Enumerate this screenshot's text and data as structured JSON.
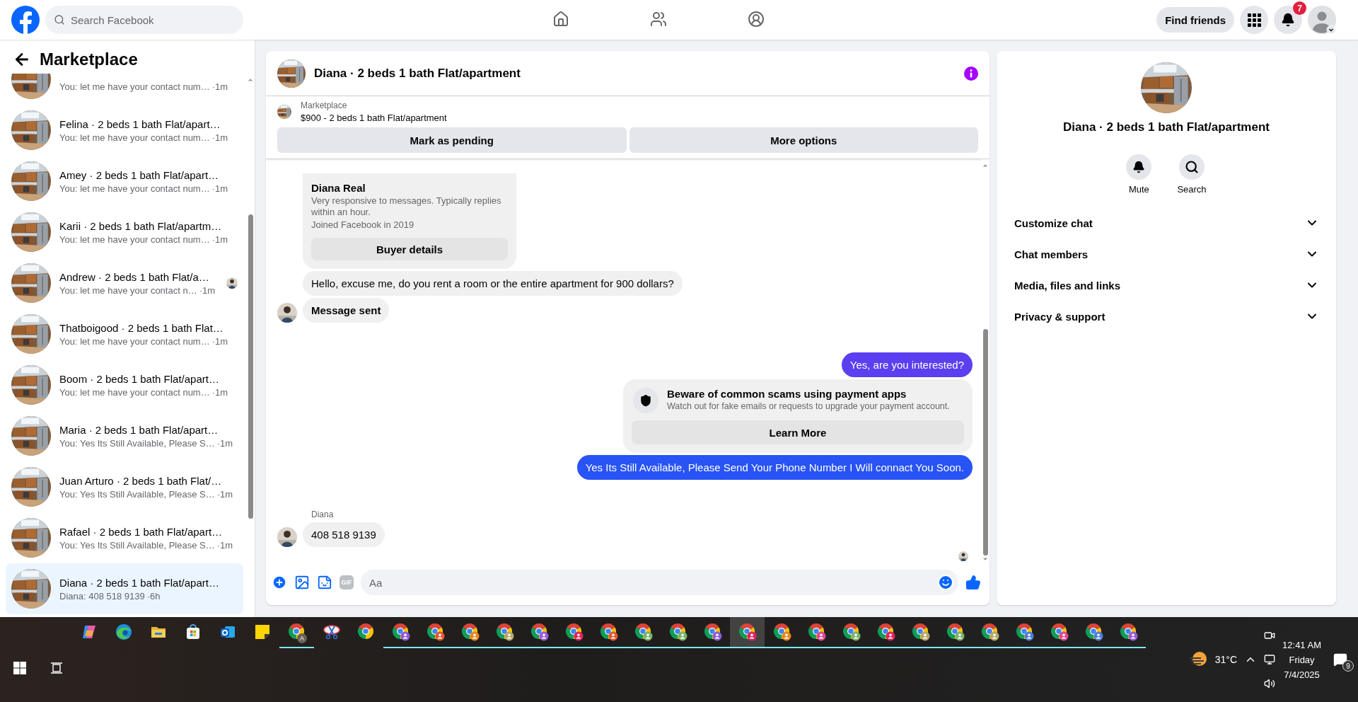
{
  "top_bar": {
    "search": {
      "placeholder": "Search Facebook"
    },
    "nav": [
      {
        "kind": "home",
        "selected": false
      },
      {
        "kind": "friends",
        "selected": false
      },
      {
        "kind": "groups",
        "selected": false
      }
    ],
    "find_friends": "Find friends",
    "notifications_badge": "7"
  },
  "sidebar": {
    "title": "Marketplace",
    "conversations": [
      {
        "preview": "You: let me have your contact num…",
        "time": "·1m",
        "selected": false,
        "seen_avatar": false
      },
      {
        "title": "Felina · 2 beds 1 bath Flat/apart…",
        "preview": "You: let me have your contact num…",
        "time": "·1m",
        "selected": false,
        "seen_avatar": false
      },
      {
        "title": "Amey · 2 beds 1 bath Flat/apart…",
        "preview": "You: let me have your contact num…",
        "time": "·1m",
        "selected": false,
        "seen_avatar": false
      },
      {
        "title": "Karii · 2 beds 1 bath Flat/apartm…",
        "preview": "You: let me have your contact num…",
        "time": "·1m",
        "selected": false,
        "seen_avatar": false
      },
      {
        "title": "Andrew · 2 beds 1 bath Flat/a…",
        "preview": "You: let me have your contact n…",
        "time": "·1m",
        "selected": false,
        "seen_avatar": true
      },
      {
        "title": "Thatboigood · 2 beds 1 bath Flat…",
        "preview": "You: let me have your contact num…",
        "time": "·1m",
        "selected": false,
        "seen_avatar": false
      },
      {
        "title": "Boom · 2 beds 1 bath Flat/apart…",
        "preview": "You: let me have your contact num…",
        "time": "·1m",
        "selected": false,
        "seen_avatar": false
      },
      {
        "title": "Maria · 2 beds 1 bath Flat/apart…",
        "preview": "You: Yes Its Still Available, Please S…",
        "time": "·1m",
        "selected": false,
        "seen_avatar": false
      },
      {
        "title": "Juan Arturo · 2 beds 1 bath Flat/…",
        "preview": "You: Yes Its Still Available, Please S…",
        "time": "·1m",
        "selected": false,
        "seen_avatar": false
      },
      {
        "title": "Rafael · 2 beds 1 bath Flat/apart…",
        "preview": "You: Yes Its Still Available, Please S…",
        "time": "·1m",
        "selected": false,
        "seen_avatar": false
      },
      {
        "title": "Diana · 2 beds 1 bath Flat/apart…",
        "preview": "Diana: 408 518 9139",
        "time": "·6h",
        "selected": true,
        "seen_avatar": false
      }
    ]
  },
  "chat": {
    "title": "Diana · 2 beds 1 bath Flat/apartment",
    "listing": {
      "label": "Marketplace",
      "price_title": "$900 - 2 beds 1 bath Flat/apartment",
      "buttons": [
        "Mark as pending",
        "More options"
      ]
    },
    "messages": [
      {
        "kind": "profile_card",
        "name": "Diana Real",
        "lines": [
          "Very responsive to messages. Typically replies within an hour.",
          "Joined Facebook in 2019"
        ],
        "button": "Buyer details"
      },
      {
        "kind": "text",
        "outgoing": false,
        "text": "Hello, excuse me, do you rent a room or the entire apartment for 900 dollars?",
        "avatar": false,
        "bold": false
      },
      {
        "kind": "text",
        "outgoing": false,
        "text": "Message sent",
        "avatar": true,
        "bold": true
      },
      {
        "kind": "text",
        "outgoing": true,
        "text": "Yes, are you interested?",
        "color": "#5b3ff0"
      },
      {
        "kind": "notice",
        "title": "Beware of common scams using payment apps",
        "text": "Watch out for fake emails or requests to upgrade your payment account.",
        "button": "Learn More"
      },
      {
        "kind": "text",
        "outgoing": true,
        "text": "Yes Its Still Available, Please Send Your Phone Number I Will connact You Soon.",
        "color": "#2853f5"
      },
      {
        "kind": "text",
        "outgoing": false,
        "sender": "Diana",
        "text": "408 518 9139",
        "avatar": true,
        "bold": false
      }
    ],
    "seen": true,
    "composer": {
      "placeholder": "Aa",
      "gif_label": "GIF"
    }
  },
  "details": {
    "title": "Diana · 2 beds 1 bath Flat/apartment",
    "actions": [
      {
        "kind": "mute",
        "label": "Mute"
      },
      {
        "kind": "search",
        "label": "Search"
      }
    ],
    "sections": [
      {
        "label": "Customize chat",
        "expanded": false
      },
      {
        "label": "Chat members",
        "expanded": false
      },
      {
        "label": "Media, files and links",
        "expanded": false
      },
      {
        "label": "Privacy & support",
        "expanded": false
      }
    ]
  },
  "taskbar": {
    "apps": [
      {
        "kind": "copilot",
        "running": false,
        "selected": false
      },
      {
        "kind": "edge",
        "running": false,
        "selected": false
      },
      {
        "kind": "explorer",
        "running": false,
        "selected": false
      },
      {
        "kind": "store",
        "running": false,
        "selected": false
      },
      {
        "kind": "outlook",
        "running": false,
        "selected": false
      },
      {
        "kind": "sticky_notes",
        "running": false,
        "selected": false
      },
      {
        "kind": "chrome",
        "badge": "A",
        "running": true,
        "selected": false
      },
      {
        "kind": "snipping",
        "running": false,
        "selected": false
      },
      {
        "kind": "chrome",
        "running": false,
        "selected": false
      },
      {
        "kind": "chrome",
        "color": "#8e5bd6",
        "running": true,
        "selected": false
      },
      {
        "kind": "chrome",
        "color": "#e4572e",
        "running": true,
        "selected": false
      },
      {
        "kind": "chrome",
        "color": "#e8871e",
        "running": true,
        "selected": false
      },
      {
        "kind": "chrome",
        "color": "#b7a76a",
        "running": true,
        "selected": false
      },
      {
        "kind": "chrome",
        "color": "#9a5bd6",
        "running": true,
        "selected": false
      },
      {
        "kind": "chrome",
        "color": "#e0245e",
        "running": true,
        "selected": false
      },
      {
        "kind": "chrome",
        "color": "#e4572e",
        "running": true,
        "selected": false
      },
      {
        "kind": "chrome",
        "color": "#7cb36a",
        "running": true,
        "selected": false
      },
      {
        "kind": "chrome",
        "color": "#7cb36a",
        "running": true,
        "selected": false
      },
      {
        "kind": "chrome",
        "color": "#8e5bd6",
        "running": true,
        "selected": false
      },
      {
        "kind": "chrome",
        "color": "#e0245e",
        "running": true,
        "selected": true
      },
      {
        "kind": "chrome",
        "color": "#e8871e",
        "running": true,
        "selected": false
      },
      {
        "kind": "chrome",
        "color": "#e0468f",
        "running": true,
        "selected": false
      },
      {
        "kind": "chrome",
        "color": "#7cb36a",
        "running": true,
        "selected": false
      },
      {
        "kind": "chrome",
        "color": "#e0245e",
        "running": true,
        "selected": false
      },
      {
        "kind": "chrome",
        "color": "#b7a76a",
        "running": true,
        "selected": false
      },
      {
        "kind": "chrome",
        "color": "#7cb36a",
        "running": true,
        "selected": false
      },
      {
        "kind": "chrome",
        "color": "#b7a76a",
        "running": true,
        "selected": false
      },
      {
        "kind": "chrome",
        "color": "#4f7fd9",
        "running": true,
        "selected": false
      },
      {
        "kind": "chrome",
        "color": "#e0468f",
        "running": true,
        "selected": false
      },
      {
        "kind": "chrome",
        "color": "#4f7fd9",
        "running": true,
        "selected": false
      },
      {
        "kind": "chrome",
        "color": "#9a5bd6",
        "running": true,
        "selected": false
      }
    ],
    "weather": "31°C",
    "clock": {
      "time": "12:41 AM",
      "day": "Friday",
      "date": "7/4/2025"
    },
    "notifications": "9"
  }
}
